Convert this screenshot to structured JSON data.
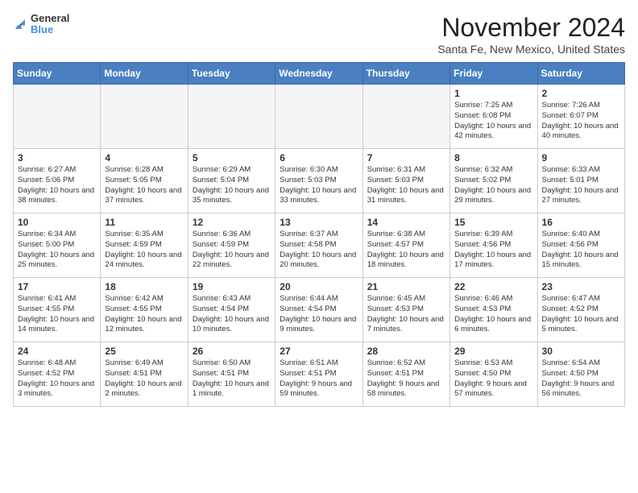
{
  "header": {
    "logo_general": "General",
    "logo_blue": "Blue",
    "month_title": "November 2024",
    "location": "Santa Fe, New Mexico, United States"
  },
  "days_of_week": [
    "Sunday",
    "Monday",
    "Tuesday",
    "Wednesday",
    "Thursday",
    "Friday",
    "Saturday"
  ],
  "weeks": [
    [
      {
        "day": "",
        "info": ""
      },
      {
        "day": "",
        "info": ""
      },
      {
        "day": "",
        "info": ""
      },
      {
        "day": "",
        "info": ""
      },
      {
        "day": "",
        "info": ""
      },
      {
        "day": "1",
        "info": "Sunrise: 7:25 AM\nSunset: 6:08 PM\nDaylight: 10 hours and 42 minutes."
      },
      {
        "day": "2",
        "info": "Sunrise: 7:26 AM\nSunset: 6:07 PM\nDaylight: 10 hours and 40 minutes."
      }
    ],
    [
      {
        "day": "3",
        "info": "Sunrise: 6:27 AM\nSunset: 5:06 PM\nDaylight: 10 hours and 38 minutes."
      },
      {
        "day": "4",
        "info": "Sunrise: 6:28 AM\nSunset: 5:05 PM\nDaylight: 10 hours and 37 minutes."
      },
      {
        "day": "5",
        "info": "Sunrise: 6:29 AM\nSunset: 5:04 PM\nDaylight: 10 hours and 35 minutes."
      },
      {
        "day": "6",
        "info": "Sunrise: 6:30 AM\nSunset: 5:03 PM\nDaylight: 10 hours and 33 minutes."
      },
      {
        "day": "7",
        "info": "Sunrise: 6:31 AM\nSunset: 5:03 PM\nDaylight: 10 hours and 31 minutes."
      },
      {
        "day": "8",
        "info": "Sunrise: 6:32 AM\nSunset: 5:02 PM\nDaylight: 10 hours and 29 minutes."
      },
      {
        "day": "9",
        "info": "Sunrise: 6:33 AM\nSunset: 5:01 PM\nDaylight: 10 hours and 27 minutes."
      }
    ],
    [
      {
        "day": "10",
        "info": "Sunrise: 6:34 AM\nSunset: 5:00 PM\nDaylight: 10 hours and 25 minutes."
      },
      {
        "day": "11",
        "info": "Sunrise: 6:35 AM\nSunset: 4:59 PM\nDaylight: 10 hours and 24 minutes."
      },
      {
        "day": "12",
        "info": "Sunrise: 6:36 AM\nSunset: 4:59 PM\nDaylight: 10 hours and 22 minutes."
      },
      {
        "day": "13",
        "info": "Sunrise: 6:37 AM\nSunset: 4:58 PM\nDaylight: 10 hours and 20 minutes."
      },
      {
        "day": "14",
        "info": "Sunrise: 6:38 AM\nSunset: 4:57 PM\nDaylight: 10 hours and 18 minutes."
      },
      {
        "day": "15",
        "info": "Sunrise: 6:39 AM\nSunset: 4:56 PM\nDaylight: 10 hours and 17 minutes."
      },
      {
        "day": "16",
        "info": "Sunrise: 6:40 AM\nSunset: 4:56 PM\nDaylight: 10 hours and 15 minutes."
      }
    ],
    [
      {
        "day": "17",
        "info": "Sunrise: 6:41 AM\nSunset: 4:55 PM\nDaylight: 10 hours and 14 minutes."
      },
      {
        "day": "18",
        "info": "Sunrise: 6:42 AM\nSunset: 4:55 PM\nDaylight: 10 hours and 12 minutes."
      },
      {
        "day": "19",
        "info": "Sunrise: 6:43 AM\nSunset: 4:54 PM\nDaylight: 10 hours and 10 minutes."
      },
      {
        "day": "20",
        "info": "Sunrise: 6:44 AM\nSunset: 4:54 PM\nDaylight: 10 hours and 9 minutes."
      },
      {
        "day": "21",
        "info": "Sunrise: 6:45 AM\nSunset: 4:53 PM\nDaylight: 10 hours and 7 minutes."
      },
      {
        "day": "22",
        "info": "Sunrise: 6:46 AM\nSunset: 4:53 PM\nDaylight: 10 hours and 6 minutes."
      },
      {
        "day": "23",
        "info": "Sunrise: 6:47 AM\nSunset: 4:52 PM\nDaylight: 10 hours and 5 minutes."
      }
    ],
    [
      {
        "day": "24",
        "info": "Sunrise: 6:48 AM\nSunset: 4:52 PM\nDaylight: 10 hours and 3 minutes."
      },
      {
        "day": "25",
        "info": "Sunrise: 6:49 AM\nSunset: 4:51 PM\nDaylight: 10 hours and 2 minutes."
      },
      {
        "day": "26",
        "info": "Sunrise: 6:50 AM\nSunset: 4:51 PM\nDaylight: 10 hours and 1 minute."
      },
      {
        "day": "27",
        "info": "Sunrise: 6:51 AM\nSunset: 4:51 PM\nDaylight: 9 hours and 59 minutes."
      },
      {
        "day": "28",
        "info": "Sunrise: 6:52 AM\nSunset: 4:51 PM\nDaylight: 9 hours and 58 minutes."
      },
      {
        "day": "29",
        "info": "Sunrise: 6:53 AM\nSunset: 4:50 PM\nDaylight: 9 hours and 57 minutes."
      },
      {
        "day": "30",
        "info": "Sunrise: 6:54 AM\nSunset: 4:50 PM\nDaylight: 9 hours and 56 minutes."
      }
    ]
  ]
}
